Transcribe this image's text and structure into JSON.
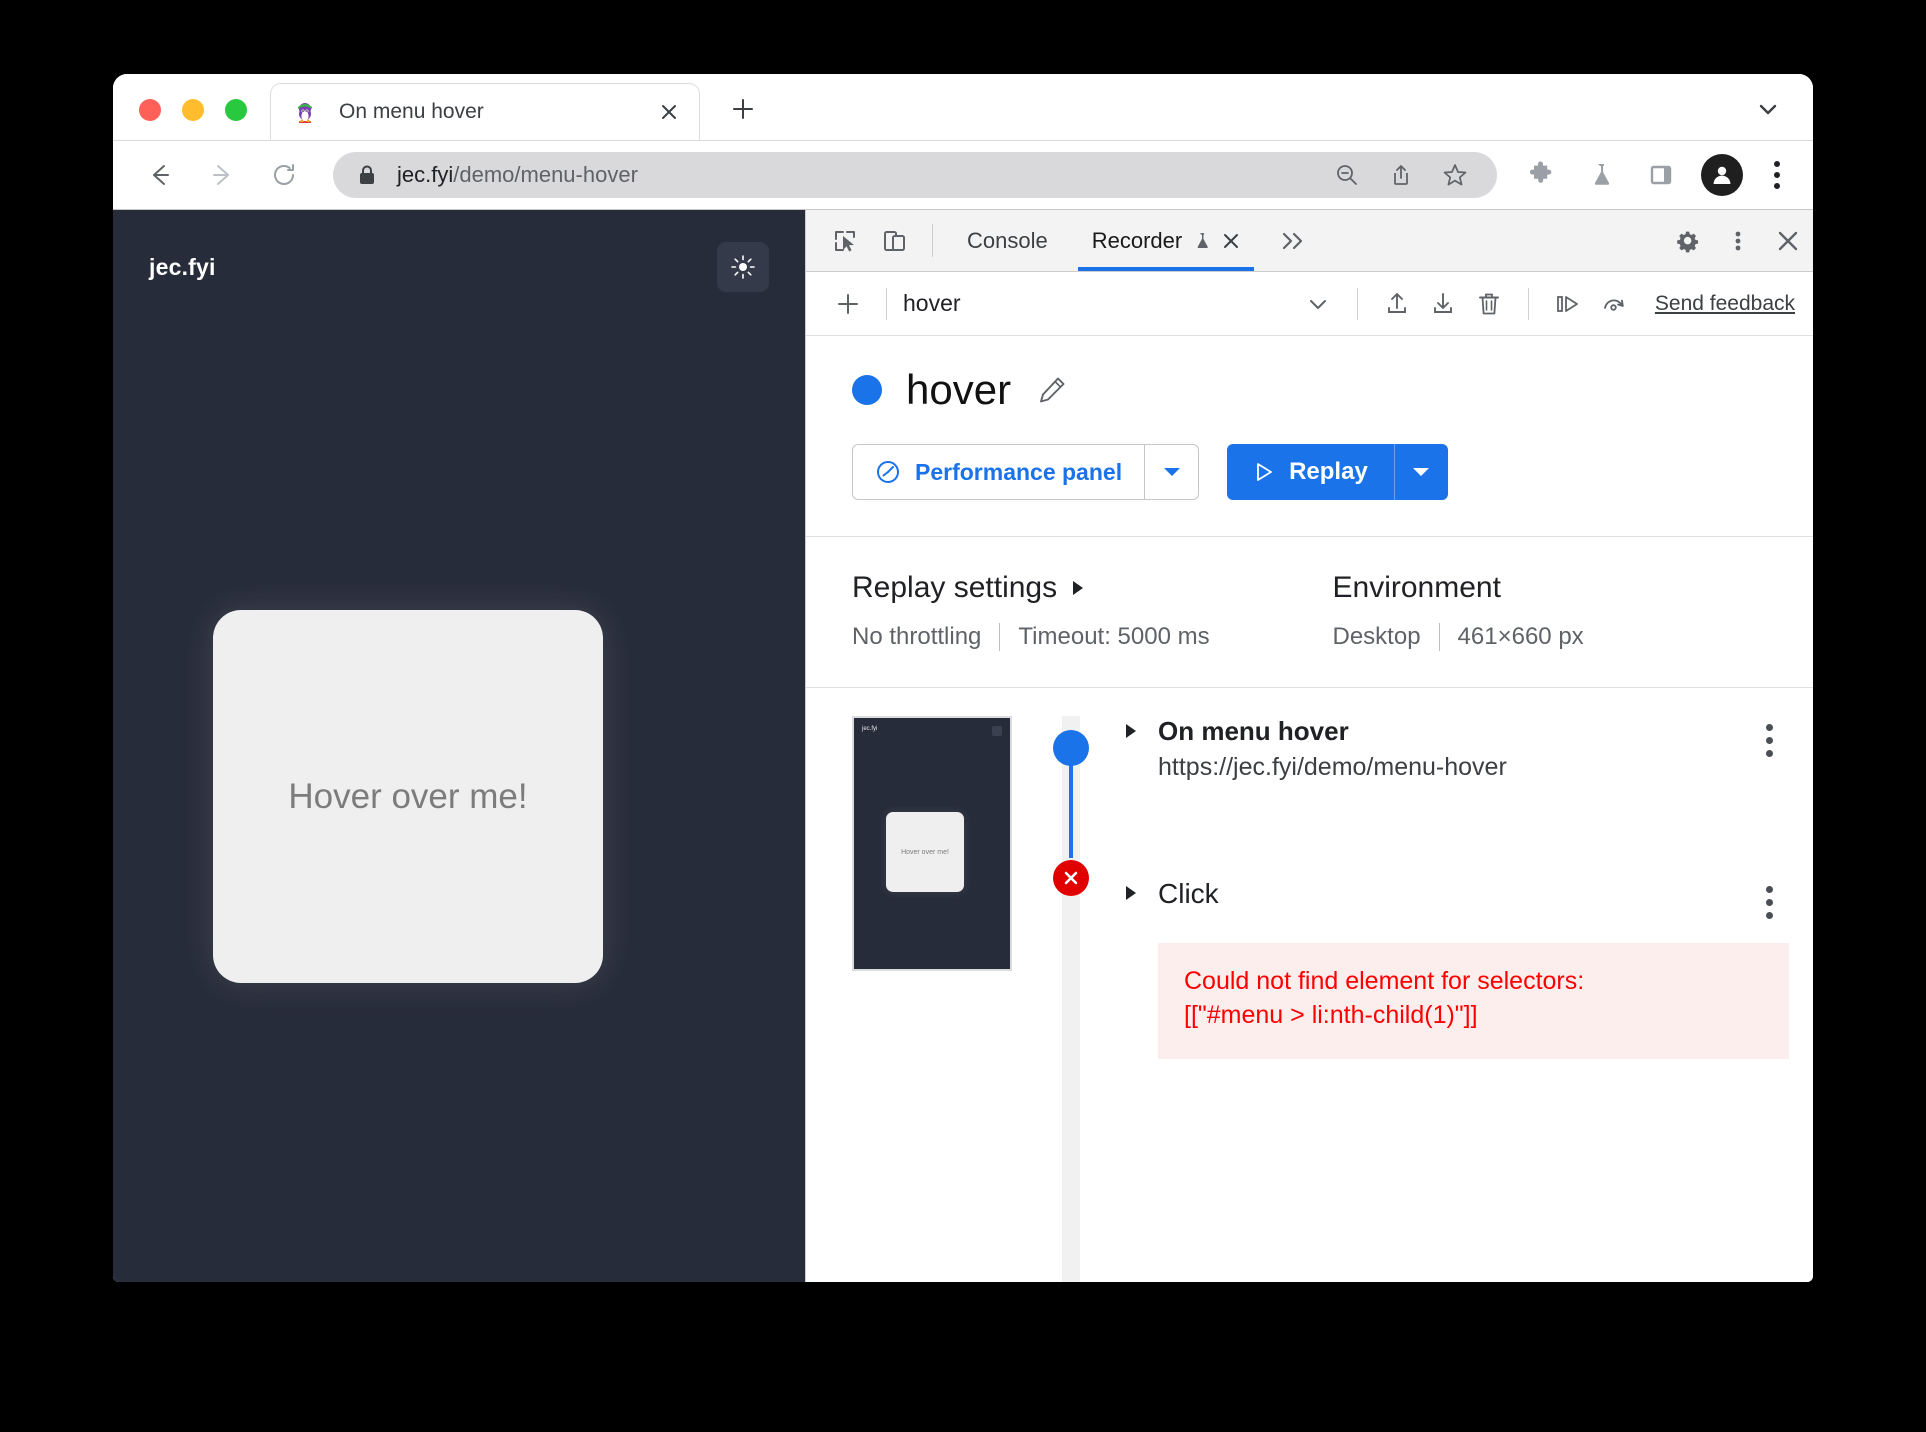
{
  "browser": {
    "traffic_lights": [
      "close",
      "minimize",
      "maximize"
    ],
    "tab": {
      "title": "On menu hover",
      "favicon": "penguin-favicon",
      "close_label": "×"
    },
    "new_tab_label": "+",
    "toolbar": {
      "back_icon": "back-arrow-icon",
      "forward_icon": "forward-arrow-icon",
      "reload_icon": "reload-icon",
      "lock_icon": "lock-icon",
      "url_domain": "jec.fyi",
      "url_path": "/demo/menu-hover",
      "zoom_icon": "zoom-out-icon",
      "share_icon": "share-icon",
      "bookmark_icon": "star-icon",
      "extensions_icon": "puzzle-icon",
      "labs_icon": "flask-icon",
      "sidepanel_icon": "side-panel-icon",
      "profile_icon": "avatar-icon",
      "menu_icon": "three-dots-icon"
    }
  },
  "page": {
    "brand": "jec.fyi",
    "theme_toggle_icon": "sun-icon",
    "card_text": "Hover over me!",
    "background": "#272c3a"
  },
  "devtools": {
    "inspect_icon": "inspect-element-icon",
    "device_icon": "device-toolbar-icon",
    "tabs": [
      {
        "label": "Console",
        "active": false
      },
      {
        "label": "Recorder",
        "active": true,
        "experiment_icon": "flask-icon",
        "close_icon": "close-icon"
      }
    ],
    "more_tabs_icon": "chevrons-right-icon",
    "settings_icon": "gear-icon",
    "menu_icon": "three-dots-icon",
    "close_icon": "close-icon",
    "recorder": {
      "add_icon": "plus-icon",
      "recording_name": "hover",
      "name_caret_icon": "chevron-down-icon",
      "import_icon": "upload-icon",
      "export_icon": "download-icon",
      "delete_icon": "trash-icon",
      "step_by_step_icon": "play-step-icon",
      "slow_replay_icon": "speed-replay-icon",
      "send_feedback": "Send feedback",
      "title": "hover",
      "title_bullet_color": "#1a73e8",
      "edit_icon": "pencil-icon",
      "performance_button": {
        "label": "Performance panel",
        "icon": "performance-gauge-icon",
        "caret_icon": "caret-down-icon"
      },
      "replay_button": {
        "label": "Replay",
        "icon": "play-triangle-icon",
        "caret_icon": "caret-down-icon"
      },
      "replay_settings": {
        "heading": "Replay settings",
        "expand_icon": "caret-right-icon",
        "throttling": "No throttling",
        "timeout": "Timeout: 5000 ms"
      },
      "environment": {
        "heading": "Environment",
        "device": "Desktop",
        "viewport": "461×660 px"
      },
      "thumbnail": {
        "brand": "jec.fyi",
        "card_text": "Hover over me!"
      },
      "steps": [
        {
          "title": "On menu hover",
          "subtitle": "https://jec.fyi/demo/menu-hover",
          "caret_icon": "caret-right-icon",
          "menu_icon": "three-dots-icon",
          "status": "ok"
        },
        {
          "title": "Click",
          "subtitle": "",
          "caret_icon": "caret-right-icon",
          "menu_icon": "three-dots-icon",
          "status": "error"
        }
      ],
      "error": {
        "line1": "Could not find element for selectors:",
        "line2": "[[\"#menu > li:nth-child(1)\"]]",
        "color": "#ff0000",
        "background": "#fdeeee"
      }
    }
  }
}
